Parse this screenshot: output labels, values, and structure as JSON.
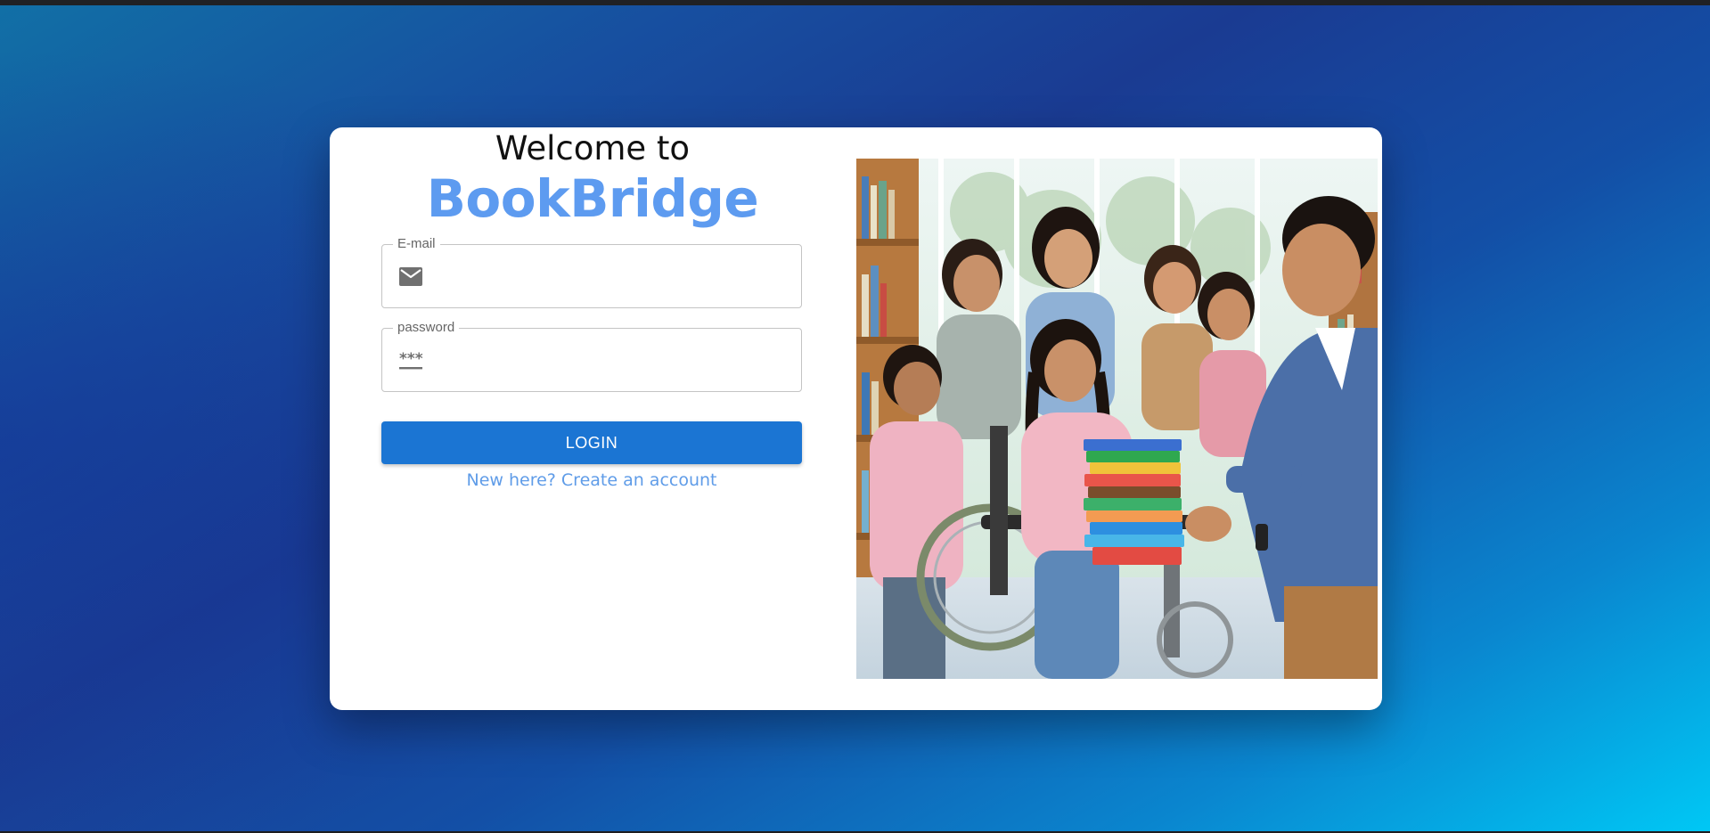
{
  "login": {
    "welcome_text": "Welcome to",
    "brand_name": "BookBridge",
    "email_label": "E-mail",
    "email_value": "",
    "email_icon": "envelope-icon",
    "password_label": "password",
    "password_value": "",
    "password_icon": "password-icon",
    "login_button_label": "LOGIN",
    "signup_link_text": "New here? Create an account"
  },
  "hero_image": {
    "description_icon": "library-illustration"
  },
  "colors": {
    "brand": "#5d9bf0",
    "primary_button": "#1b75d3",
    "link": "#5f9ce8",
    "background_start": "#1170a6",
    "background_end": "#00c8f5"
  }
}
